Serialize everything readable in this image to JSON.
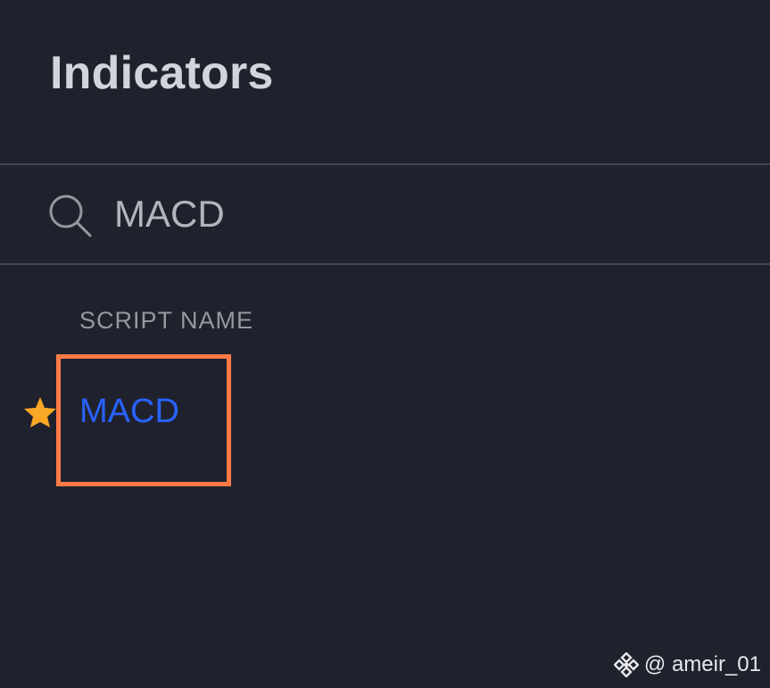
{
  "panel": {
    "title": "Indicators"
  },
  "search": {
    "icon": "search-icon",
    "value": "MACD",
    "placeholder": "Search"
  },
  "results": {
    "column_header": "SCRIPT NAME",
    "items": [
      {
        "label": "MACD",
        "favorite": true,
        "icon": "star-icon",
        "label_color": "#2962ff",
        "star_color": "#f9a825"
      }
    ]
  },
  "annotation": {
    "highlight_color": "#ff7a45"
  },
  "watermark": {
    "icon": "binance-icon",
    "text": "@ ameir_01"
  },
  "colors": {
    "background": "#1f222d",
    "divider": "#434651",
    "title": "#d1d4dc",
    "muted_text": "#9598a1"
  }
}
